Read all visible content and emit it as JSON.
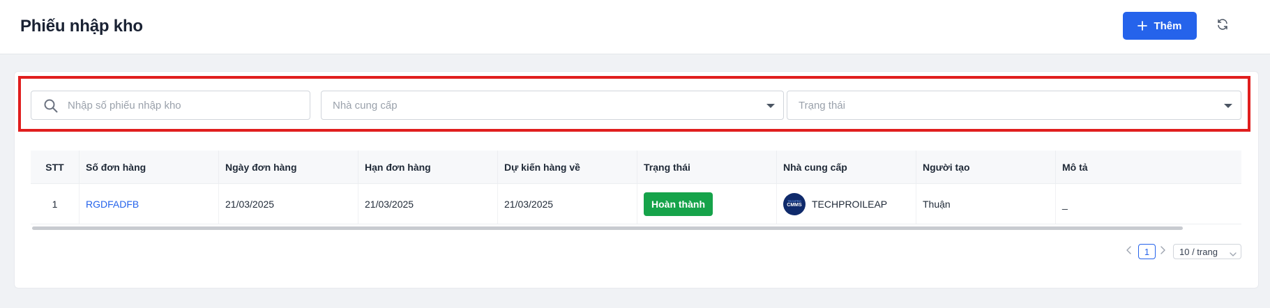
{
  "header": {
    "title": "Phiếu nhập kho",
    "add_label": "Thêm",
    "accent": "#2563eb"
  },
  "filters": {
    "search_placeholder": "Nhập số phiếu nhập kho",
    "supplier_placeholder": "Nhà cung cấp",
    "status_placeholder": "Trạng thái",
    "highlight_color": "#e01e1e"
  },
  "table": {
    "columns": [
      "STT",
      "Số đơn hàng",
      "Ngày đơn hàng",
      "Hạn đơn hàng",
      "Dự kiến hàng về",
      "Trạng thái",
      "Nhà cung cấp",
      "Người tạo",
      "Mô tả"
    ],
    "rows": [
      {
        "stt": "1",
        "order_no": "RGDFADFB",
        "order_date": "21/03/2025",
        "due_date": "21/03/2025",
        "expected_date": "21/03/2025",
        "status": "Hoàn thành",
        "status_color": "#16a34a",
        "supplier": "TECHPROILEAP",
        "supplier_logo_text": "CMMS",
        "supplier_logo_sub": "TECHPRO",
        "creator": "Thuận",
        "description": "_"
      }
    ]
  },
  "pagination": {
    "current_page": "1",
    "page_size": "10 / trang"
  }
}
